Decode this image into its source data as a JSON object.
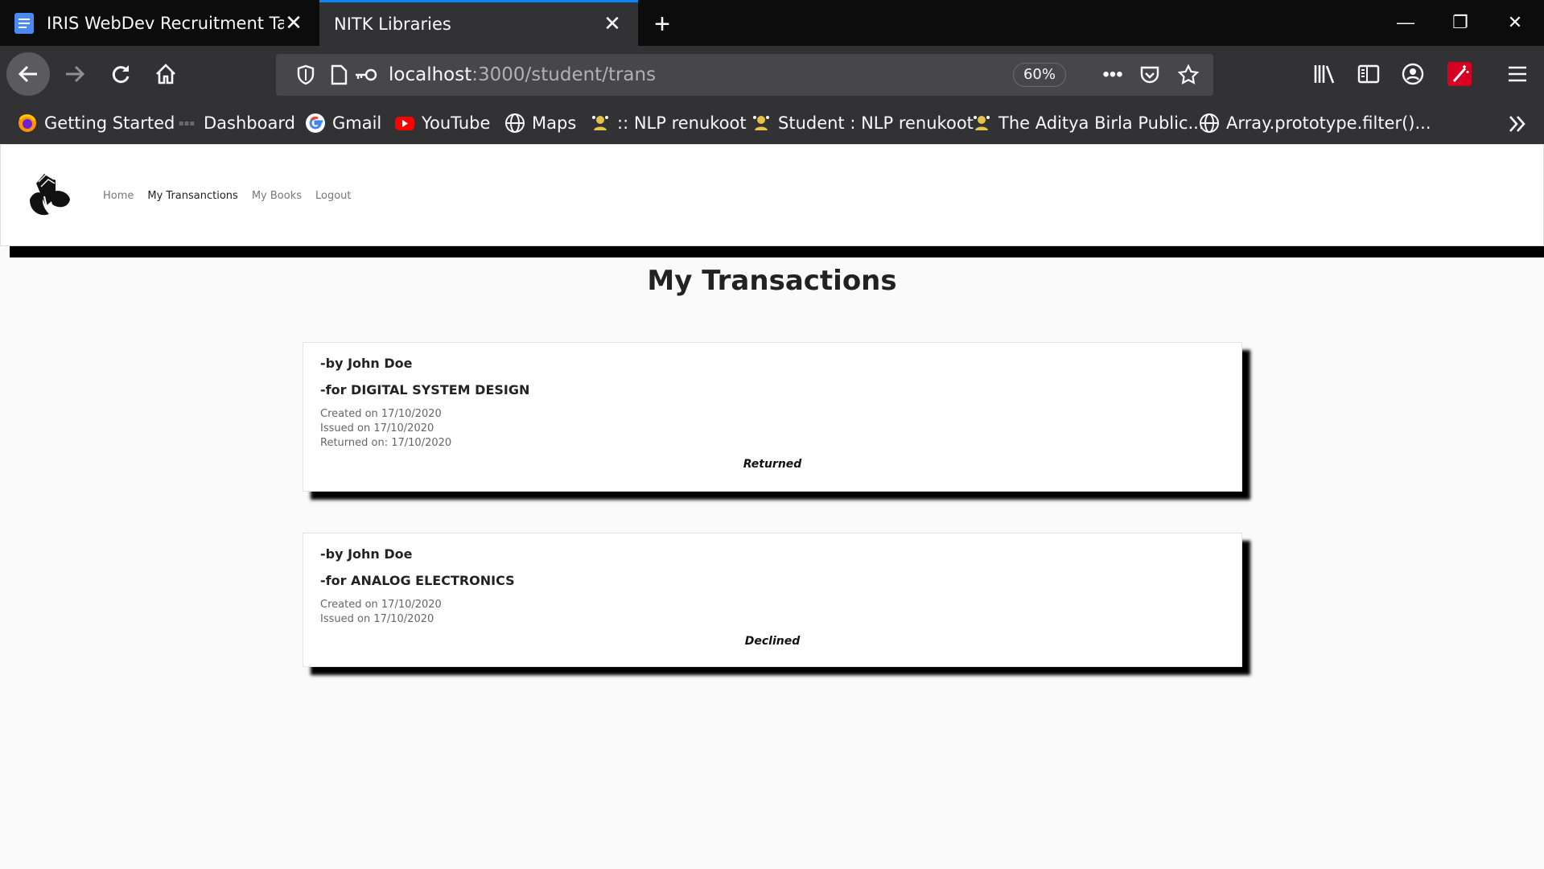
{
  "browser": {
    "tabs": [
      {
        "title": "IRIS WebDev Recruitment Task"
      },
      {
        "title": "NITK Libraries"
      }
    ],
    "url": {
      "host": "localhost",
      "path": ":3000/student/trans"
    },
    "zoom": "60%",
    "bookmarks": [
      {
        "label": "Getting Started",
        "icon": "firefox-icon"
      },
      {
        "label": "Dashboard",
        "icon": "dashboard-icon"
      },
      {
        "label": "Gmail",
        "icon": "google-icon"
      },
      {
        "label": "YouTube",
        "icon": "youtube-icon"
      },
      {
        "label": "Maps",
        "icon": "globe-icon"
      },
      {
        "label": ":: NLP renukoot",
        "icon": "nlp-icon"
      },
      {
        "label": "Student : NLP renukoot",
        "icon": "nlp-icon"
      },
      {
        "label": "The Aditya Birla Public...",
        "icon": "nlp-icon"
      },
      {
        "label": "Array.prototype.filter()...",
        "icon": "globe-icon"
      }
    ]
  },
  "site": {
    "nav": [
      {
        "label": "Home",
        "active": false
      },
      {
        "label": "My Transanctions",
        "active": true
      },
      {
        "label": "My Books",
        "active": false
      },
      {
        "label": "Logout",
        "active": false
      }
    ],
    "page_title": "My Transactions",
    "transactions": [
      {
        "by": "-by John Doe",
        "for": "-for DIGITAL SYSTEM DESIGN",
        "created": "Created on 17/10/2020",
        "issued": "Issued on 17/10/2020",
        "returned": "Returned on: 17/10/2020",
        "status": "Returned"
      },
      {
        "by": "-by John Doe",
        "for": "-for ANALOG ELECTRONICS",
        "created": "Created on 17/10/2020",
        "issued": "Issued on 17/10/2020",
        "status": "Declined"
      }
    ]
  },
  "colors": {
    "tab_accent": "#0a84ff",
    "chrome_dark": "#0c0c0d",
    "chrome_toolbar": "#323234",
    "page_bg": "#fafafa"
  }
}
